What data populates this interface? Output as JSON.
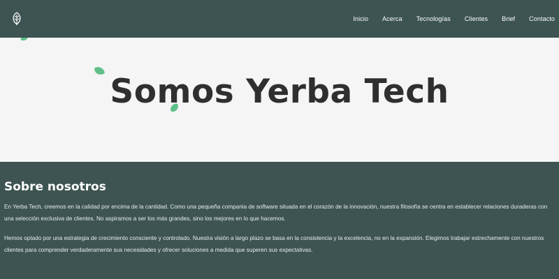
{
  "nav": {
    "logo_icon": "leaf-logo-icon",
    "links": [
      "Inicio",
      "Acerca",
      "Tecnologías",
      "Clientes",
      "Brief",
      "Contacto"
    ]
  },
  "hero": {
    "title": "Somos Yerba Tech"
  },
  "about": {
    "title": "Sobre nosotros",
    "paragraphs": [
      "En Yerba Tech, creemos en la calidad por encima de la cantidad. Como una pequeña compania de software situada en el corazón de la innovación, nuestra filosofía se centra en establecer relaciones duraderas con una selección exclusiva de clientes. No aspiramos a ser los más grandes, sino los mejores en lo que hacemos.",
      "Hemos optado por una estrategia de crecimiento consciente y controlado. Nuestra visión a largo plazo se basa en la consistencia y la excelencia, no en la expansión. Elegimos trabajar estrechamente con nuestros clientes para comprender verdaderamente sus necesidades y ofrecer soluciones a medida que superen sus expectativas."
    ]
  },
  "colors": {
    "primary": "#3d5452",
    "hero_bg": "#f5f5f5",
    "leaf": "#5fbf88",
    "title_text": "#2f2f2f"
  }
}
